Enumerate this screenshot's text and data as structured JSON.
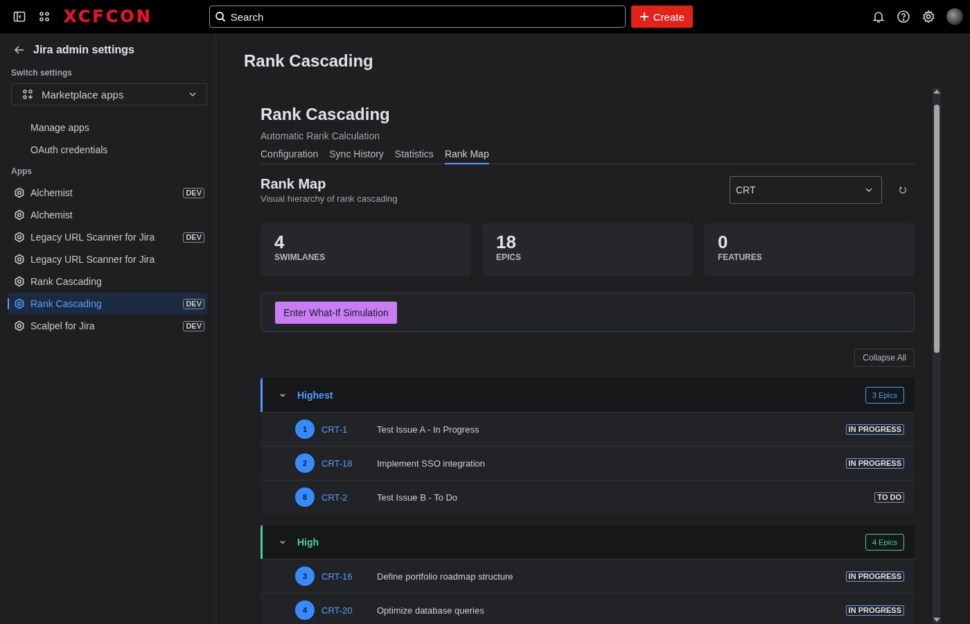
{
  "topbar": {
    "logo": "XCFCON",
    "search": {
      "placeholder": "Search"
    },
    "create": "Create"
  },
  "sidebar": {
    "back_title": "Jira admin settings",
    "switch_label": "Switch settings",
    "switcher": "Marketplace apps",
    "links": [
      "Manage apps",
      "OAuth credentials"
    ],
    "apps_label": "Apps",
    "items": [
      {
        "label": "Alchemist",
        "badge": "DEV",
        "selected": false
      },
      {
        "label": "Alchemist",
        "selected": false
      },
      {
        "label": "Legacy URL Scanner for Jira",
        "badge": "DEV",
        "selected": false
      },
      {
        "label": "Legacy URL Scanner for Jira",
        "selected": false
      },
      {
        "label": "Rank Cascading",
        "selected": false
      },
      {
        "label": "Rank Cascading",
        "badge": "DEV",
        "selected": true
      },
      {
        "label": "Scalpel for Jira",
        "badge": "DEV",
        "selected": false
      }
    ]
  },
  "page_title": "Rank Cascading",
  "app": {
    "title": "Rank Cascading",
    "subtitle": "Automatic Rank Calculation",
    "tabs": [
      {
        "label": "Configuration",
        "selected": false
      },
      {
        "label": "Sync History",
        "selected": false
      },
      {
        "label": "Statistics",
        "selected": false
      },
      {
        "label": "Rank Map",
        "selected": true
      }
    ],
    "section_title": "Rank Map",
    "section_subtitle": "Visual hierarchy of rank cascading",
    "project_select": "CRT",
    "stats": [
      {
        "value": "4",
        "label": "SWIMLANES"
      },
      {
        "value": "18",
        "label": "EPICS"
      },
      {
        "value": "0",
        "label": "FEATURES"
      }
    ],
    "simulation_button": "Enter What-If Simulation",
    "collapse_button": "Collapse All",
    "lanes": [
      {
        "name": "Highest",
        "count": "3 Epics",
        "color": "#4c9aff",
        "expanded": true,
        "issues": [
          {
            "rank": "1",
            "key": "CRT-1",
            "summary": "Test Issue A - In Progress",
            "status": "IN PROGRESS",
            "kind": "in_progress"
          },
          {
            "rank": "2",
            "key": "CRT-18",
            "summary": "Implement SSO integration",
            "status": "IN PROGRESS",
            "kind": "in_progress"
          },
          {
            "rank": "8",
            "key": "CRT-2",
            "summary": "Test Issue B - To Do",
            "status": "TO DO",
            "kind": "todo"
          }
        ]
      },
      {
        "name": "High",
        "count": "4 Epics",
        "color": "#4bce97",
        "expanded": true,
        "issues": [
          {
            "rank": "3",
            "key": "CRT-16",
            "summary": "Define portfolio roadmap structure",
            "status": "IN PROGRESS",
            "kind": "in_progress"
          },
          {
            "rank": "4",
            "key": "CRT-20",
            "summary": "Optimize database queries",
            "status": "IN PROGRESS",
            "kind": "in_progress"
          }
        ]
      }
    ]
  }
}
